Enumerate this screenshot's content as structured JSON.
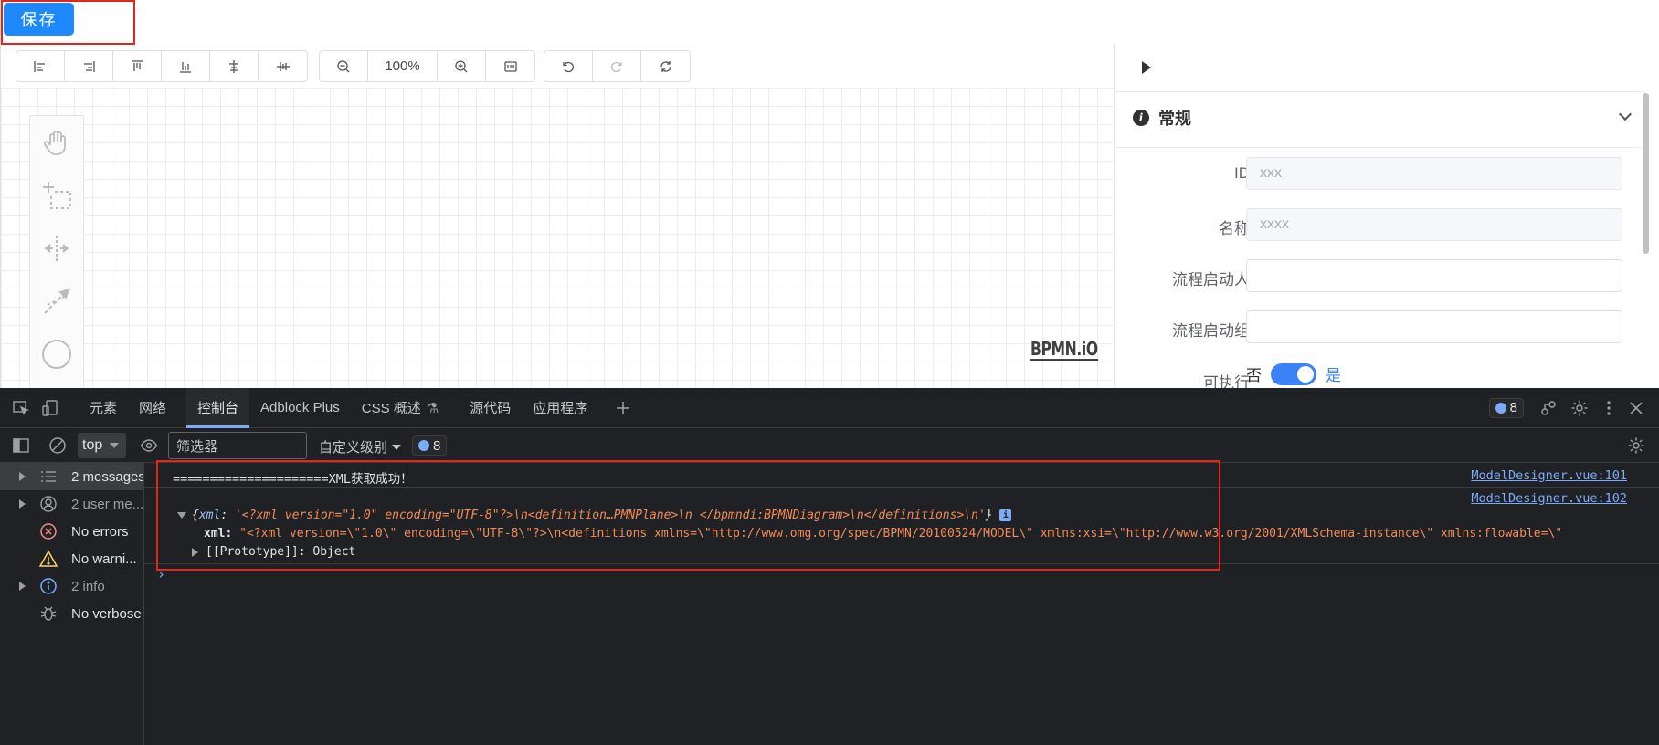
{
  "app": {
    "save_button": "保存",
    "toolbar": {
      "align_group": [
        "align-left-icon",
        "align-right-icon",
        "align-top-icon",
        "align-bottom-icon",
        "align-center-icon",
        "align-middle-icon"
      ],
      "zoom_level": "100%",
      "history_group": [
        "undo-icon",
        "redo-icon",
        "reset-icon"
      ]
    },
    "palette": [
      "hand-tool-icon",
      "lasso-tool-icon",
      "space-tool-icon",
      "connect-tool-icon",
      "start-event-icon"
    ],
    "logo": "BPMN.iO",
    "panel": {
      "section_title": "常规",
      "fields": [
        {
          "label": "ID",
          "value": "xxx",
          "disabled": true
        },
        {
          "label": "名称",
          "value": "xxxx",
          "disabled": true
        },
        {
          "label": "流程启动人",
          "value": ""
        },
        {
          "label": "流程启动组",
          "value": ""
        }
      ],
      "executable": {
        "label": "可执行",
        "off_text": "否",
        "on_text": "是",
        "on": true
      }
    }
  },
  "devtools": {
    "tabs": [
      "元素",
      "网络",
      "控制台",
      "Adblock Plus",
      "CSS 概述",
      "源代码",
      "应用程序"
    ],
    "active_tab": "控制台",
    "issues_count": "8",
    "context": "top",
    "filter_placeholder": "筛选器",
    "levels_label": "自定义级别",
    "filter_badge_count": "8",
    "sidebar": [
      {
        "label": "2 messages",
        "icon": "list-icon",
        "expandable": true,
        "selected": true
      },
      {
        "label": "2 user me...",
        "icon": "user-icon",
        "expandable": true
      },
      {
        "label": "No errors",
        "icon": "error-icon",
        "expandable": false
      },
      {
        "label": "No warni...",
        "icon": "warning-icon",
        "expandable": false
      },
      {
        "label": "2 info",
        "icon": "info-icon",
        "expandable": true
      },
      {
        "label": "No verbose",
        "icon": "bug-icon",
        "expandable": false
      }
    ],
    "console": {
      "line1": "=====================XML获取成功！",
      "line1_source": "ModelDesigner.vue:101",
      "line2_source": "ModelDesigner.vue:102",
      "obj_open": "{",
      "obj_key": "xml",
      "obj_summary": "'<?xml version=\"1.0\" encoding=\"UTF-8\"?>\\n<definition…PMNPlane>\\n  </bpmndi:BPMNDiagram>\\n</definitions>\\n'",
      "obj_close": "}",
      "xml_key": "xml:",
      "xml_value": "\"<?xml version=\\\"1.0\\\" encoding=\\\"UTF-8\\\"?>\\n<definitions xmlns=\\\"http://www.omg.org/spec/BPMN/20100524/MODEL\\\" xmlns:xsi=\\\"http://www.w3.org/2001/XMLSchema-instance\\\" xmlns:flowable=\\\"",
      "proto_key": "[[Prototype]]:",
      "proto_value": "Object"
    }
  },
  "colors": {
    "primary": "#1e88ff",
    "highlight": "#e1261c",
    "devtools_bg": "#202124",
    "link": "#7cacf8"
  }
}
